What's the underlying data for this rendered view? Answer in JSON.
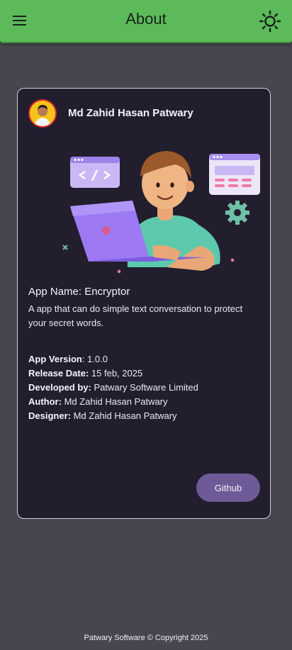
{
  "appbar": {
    "title": "About",
    "menu_icon": "menu-icon",
    "theme_icon": "sun-icon"
  },
  "profile": {
    "name": "Md Zahid Hasan Patwary",
    "avatar_icon": "profile-photo"
  },
  "app": {
    "name_label": "App Name: Encryptor",
    "description": "A app that can do simple text conversation to protect your secret words."
  },
  "info": [
    {
      "label": "App Version",
      "sep": ": ",
      "value": "1.0.0"
    },
    {
      "label": "Release Date:",
      "sep": " ",
      "value": "15 feb, 2025"
    },
    {
      "label": "Developed by:",
      "sep": " ",
      "value": "Patwary Software Limited"
    },
    {
      "label": "Author:",
      "sep": " ",
      "value": "Md Zahid Hasan Patwary"
    },
    {
      "label": "Designer:",
      "sep": " ",
      "value": "Md Zahid Hasan Patwary"
    }
  ],
  "actions": {
    "github_label": "Github"
  },
  "footer": {
    "text": "Patwary Software © Copyright 2025"
  },
  "colors": {
    "appbar": "#5dba5a",
    "background": "#48454e",
    "card": "#221e2e",
    "button": "#6d5a96"
  }
}
